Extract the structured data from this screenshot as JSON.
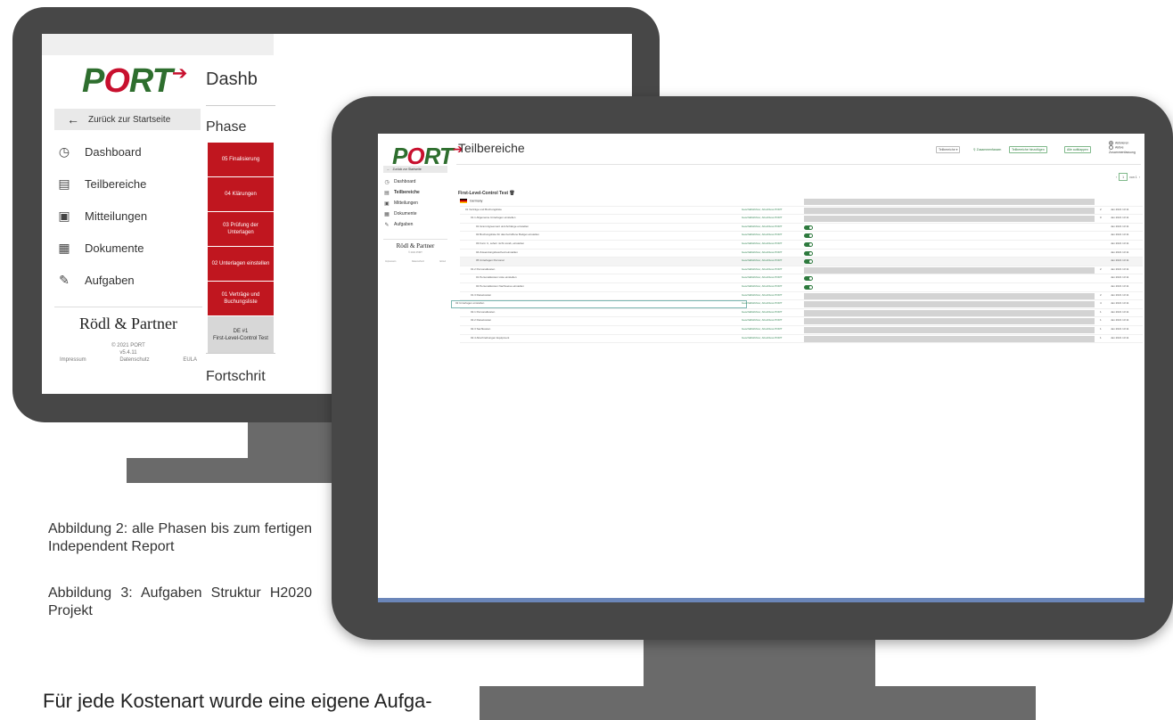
{
  "screen1": {
    "logo": "PORT",
    "back_label": "Zurück zur Startseite",
    "nav": [
      {
        "label": "Dashboard",
        "icon": "clock-icon"
      },
      {
        "label": "Teilbereiche",
        "icon": "calendar-icon"
      },
      {
        "label": "Mitteilungen",
        "icon": "clipboard-icon"
      },
      {
        "label": "Dokumente",
        "icon": "document-icon"
      },
      {
        "label": "Aufgaben",
        "icon": "edit-icon"
      }
    ],
    "company": "Rödl & Partner",
    "copyright": "© 2021 PORT",
    "version": "v5.4.11",
    "footer": {
      "impressum": "Impressum",
      "datenschutz": "Datenschutz",
      "eula": "EULA"
    },
    "title": "Dashb",
    "phase_heading": "Phase",
    "phases": [
      "05 Finalisierung",
      "04 Klärungen",
      "03 Prüfung der Unterlagen",
      "02 Unterlagen einstellen",
      "01 Verträge und Buchungsliste"
    ],
    "current_phase": {
      "line1": "DE #1",
      "line2": "First-Level-Control Test"
    },
    "progress_heading": "Fortschrit"
  },
  "captions": {
    "figure2": "Abbildung 2: alle Phasen bis zum fertigen Independent Report",
    "figure3": "Abbildung 3: Aufgaben Struktur H2020 Projekt",
    "body_text": "Für jede Kostenart wurde eine eigene Aufga-"
  },
  "screen2": {
    "logo": "PORT",
    "title": "Teilbereiche",
    "back_label": "Zurück zur Startseite",
    "nav": [
      {
        "label": "Dashboard",
        "icon": "clock-icon",
        "active": false
      },
      {
        "label": "Teilbereiche",
        "icon": "calendar-icon",
        "active": true
      },
      {
        "label": "Mitteilungen",
        "icon": "clipboard-icon",
        "active": false
      },
      {
        "label": "Dokumente",
        "icon": "document-icon",
        "active": false
      },
      {
        "label": "Aufgaben",
        "icon": "edit-icon",
        "active": false
      }
    ],
    "company": "Rödl & Partner",
    "copyright": "© 2021 PORT",
    "footer": {
      "impressum": "Impressum",
      "datenschutz": "Datenschutz",
      "eula": "EULA"
    },
    "toolbar": {
      "select": "Teilbereiche",
      "filter": "Zusammenfassen",
      "add_teilbereich": "Teilbereiche hinzufügen",
      "all_expand": "Alle aufklappen"
    },
    "radio": {
      "option1": "Aktivieren",
      "option2": "Aktive Zusammenfassung"
    },
    "pager": {
      "page": "1",
      "of": "von 1"
    },
    "section": "First-Level-Control Test",
    "rows": [
      {
        "label": "Germany",
        "status": "",
        "bar": true,
        "num": "",
        "date": "",
        "indent": 0,
        "root": true
      },
      {
        "label": "01 Verträge und Buchungsliste",
        "status": "Geschäftsführer, Abschluss PORT",
        "bar": true,
        "num": "2",
        "date": "Jan 2021 13:11",
        "indent": 6
      },
      {
        "label": "01.1 Allgemeine Unterlagen einstellen",
        "status": "Geschäftsführer, Abschluss PORT",
        "bar": true,
        "num": "0",
        "date": "Jan 2021 13:11",
        "indent": 12
      },
      {
        "label": "01 Grant Agreement und Anhänge einstellen",
        "status": "Geschäftsführer, Abschluss PORT",
        "toggle": true,
        "num": "",
        "date": "Jan 2021 13:11",
        "indent": 18
      },
      {
        "label": "02 Buchungsliste für das betroffene Budget einstellen",
        "status": "Geschäftsführer, Abschluss PORT",
        "toggle": true,
        "num": "",
        "date": "Jan 2021 13:11",
        "indent": 18
      },
      {
        "label": "03 Form C, sofern nicht vorab, einstellen",
        "status": "Geschäftsführer, Abschluss PORT",
        "toggle": true,
        "num": "",
        "date": "Jan 2021 13:11",
        "indent": 18
      },
      {
        "label": "04 Zuwendungsbescheid einstellen",
        "status": "Geschäftsführer, Abschluss PORT",
        "toggle": true,
        "num": "",
        "date": "Jan 2021 13:11",
        "indent": 18
      },
      {
        "label": "05 Unterlagen Personal",
        "status": "Geschäftsführer, Abschluss PORT",
        "toggle": true,
        "num": "",
        "date": "Jan 2021 13:11",
        "indent": 18,
        "highlight": true
      },
      {
        "label": "01.2 Personalkosten",
        "status": "Geschäftsführer, Abschluss PORT",
        "bar": true,
        "num": "2",
        "date": "Jan 2021 13:11",
        "indent": 12
      },
      {
        "label": "01 Personalkosten Liste einstellen",
        "status": "Geschäftsführer, Abschluss PORT",
        "toggle": true,
        "num": "",
        "date": "Jan 2021 13:11",
        "indent": 18
      },
      {
        "label": "02 Personalkosten Nachweise einstellen",
        "status": "Geschäftsführer, Abschluss PORT",
        "toggle": true,
        "num": "",
        "date": "Jan 2021 13:11",
        "indent": 18
      },
      {
        "label": "01.3 Reisekosten",
        "status": "Geschäftsführer, Abschluss PORT",
        "bar": true,
        "num": "2",
        "date": "Jan 2021 13:11",
        "indent": 12
      },
      {
        "label": "02 Unterlagen einstellen",
        "status": "Geschäftsführer, Abschluss PORT",
        "bar": true,
        "num": "4",
        "date": "Jan 2021 13:11",
        "indent": 6,
        "selected": true
      },
      {
        "label": "02.1 Personalkosten",
        "status": "Geschäftsführer, Abschluss PORT",
        "bar": true,
        "num": "1",
        "date": "Jan 2021 13:11",
        "indent": 12
      },
      {
        "label": "02.2 Reisekosten",
        "status": "Geschäftsführer, Abschluss PORT",
        "bar": true,
        "num": "1",
        "date": "Jan 2021 13:11",
        "indent": 12
      },
      {
        "label": "02.3 Sachkosten",
        "status": "Geschäftsführer, Abschluss PORT",
        "bar": true,
        "num": "1",
        "date": "Jan 2021 13:11",
        "indent": 12
      },
      {
        "label": "02.4 Abschreibungen Equipment",
        "status": "Geschäftsführer, Abschluss PORT",
        "bar": true,
        "num": "1",
        "date": "Jan 2021 13:11",
        "indent": 12
      }
    ]
  },
  "colors": {
    "phase_red": "#c0161f",
    "accent_green": "#2e7a3e",
    "bezel": "#474747",
    "stand": "#6a6a6a",
    "screen_underline": "#6b86b9"
  }
}
